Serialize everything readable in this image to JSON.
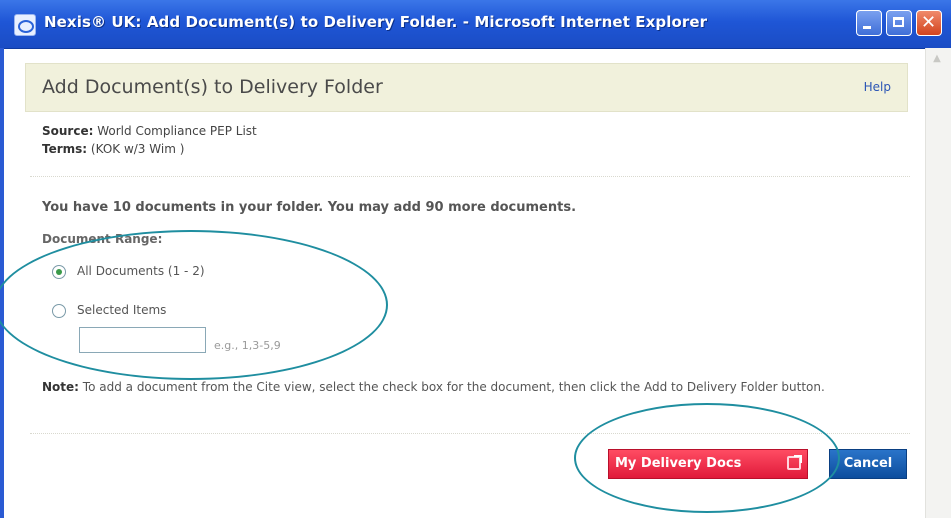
{
  "window": {
    "title": "Nexis® UK: Add Document(s) to Delivery Folder. - Microsoft Internet Explorer"
  },
  "header": {
    "title": "Add Document(s) to Delivery Folder",
    "help_label": "Help"
  },
  "meta": {
    "source_label": "Source:",
    "source_value": "World Compliance PEP List",
    "terms_label": "Terms:",
    "terms_value": "(KOK w/3 Wim )"
  },
  "folder_message": "You have 10 documents in your folder. You may add 90 more documents.",
  "range": {
    "label": "Document Range:",
    "options": [
      {
        "label": "All Documents (1 - 2)",
        "checked": true
      },
      {
        "label": "Selected Items",
        "checked": false
      }
    ],
    "input_value": "",
    "input_hint": "e.g., 1,3-5,9"
  },
  "note": {
    "label": "Note:",
    "text": "To add a document from the Cite view, select the check box for the document, then click the Add to Delivery Folder button."
  },
  "buttons": {
    "delivery_label": "My Delivery Docs",
    "cancel_label": "Cancel"
  },
  "colors": {
    "titlebar": "#1f56d6",
    "header_bg": "#f1f1dc",
    "delivery_button": "#e01a3a",
    "cancel_button": "#0d4e9e",
    "annotation": "#1f8ea0"
  }
}
